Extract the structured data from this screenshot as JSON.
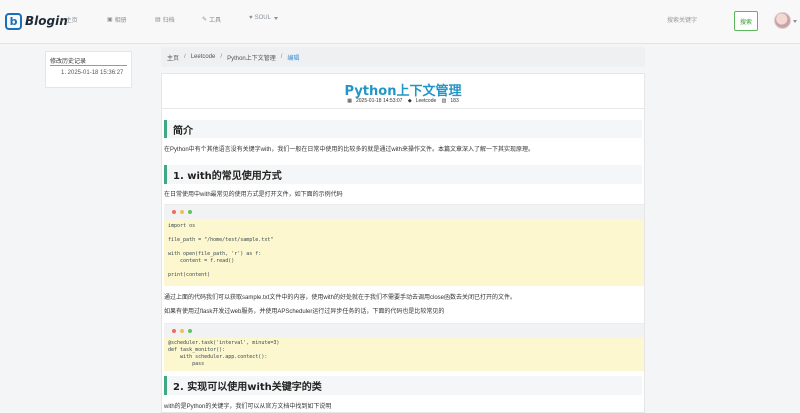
{
  "nav": {
    "logo_text": "Blogin",
    "logo_mark": "b",
    "items": [
      {
        "label": "主页",
        "icon": "home-icon"
      },
      {
        "label": "相册",
        "icon": "image-icon"
      },
      {
        "label": "归档",
        "icon": "archive-icon"
      },
      {
        "label": "工具",
        "icon": "wrench-icon"
      },
      {
        "label": "SOUL",
        "icon": "soul-icon"
      }
    ],
    "search_placeholder": "搜索关键字",
    "search_button": "搜索"
  },
  "sidebar": {
    "title": "修改历史记录",
    "items": [
      "1. 2025-01-18 15:36:27"
    ]
  },
  "breadcrumb": [
    "主页",
    "Leetcode",
    "Python上下文管理",
    "编辑"
  ],
  "post": {
    "title": "Python上下文管理",
    "date": "2025-01-18 14:53:07",
    "category": "Leetcode",
    "views": "183"
  },
  "content": {
    "h_intro": "简介",
    "p_intro": "在Python中有个其他语言没有关键字with，我们一般在日常中使用的比较多的就是通过with来操作文件。本篇文章深入了解一下其实现原理。",
    "h_with": "1. with的常见使用方式",
    "p_with": "在日常使用中with最常见的使用方式是打开文件，如下面的示例代码",
    "code1": [
      "import os",
      "",
      "file_path = \"/home/test/sample.txt\"",
      "",
      "with open(file_path, 'r') as f:",
      "    content = f.read()",
      "",
      "print(content)"
    ],
    "p_after1": "通过上面的代码我们可以获取sample.txt文件中的内容，使用with的好处就在于我们不需要手动去调用close函数去关闭已打开的文件。",
    "p_after2": "如果有使用过flask开发过web服务，并使用APScheduler运行过异步任务的话，下面的代码也是比较常见的",
    "code2": [
      "@scheduler.task('interval', minute=3)",
      "def task_monitor():",
      "    with scheduler.app.contect():",
      "        pass"
    ],
    "h_impl": "2. 实现可以使用with关键字的类",
    "p_impl": "with的是Python的关键字，我们可以从官方文档中找到如下说明"
  }
}
